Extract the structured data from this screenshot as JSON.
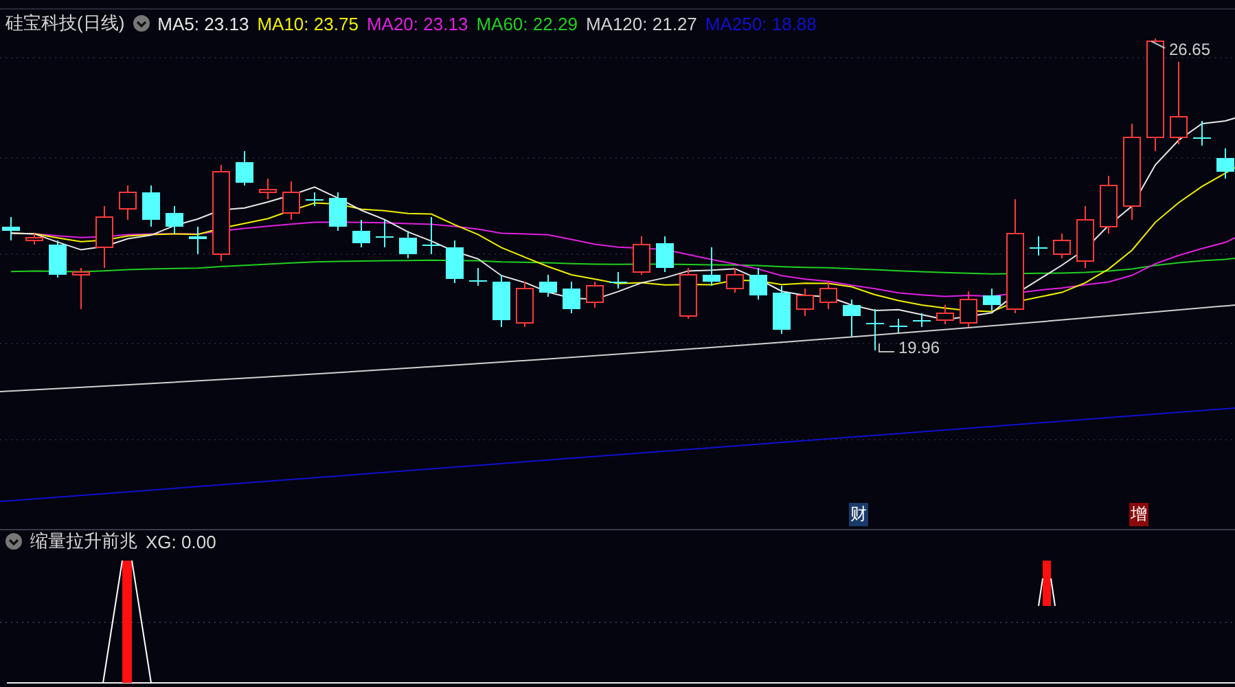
{
  "header": {
    "title": "硅宝科技(日线)",
    "readings": [
      {
        "label": "MA5:",
        "value": "23.13",
        "color": "#e8e8e8"
      },
      {
        "label": "MA10:",
        "value": "23.75",
        "color": "#f0f000"
      },
      {
        "label": "MA20:",
        "value": "23.13",
        "color": "#e020e0"
      },
      {
        "label": "MA60:",
        "value": "22.29",
        "color": "#20d020"
      },
      {
        "label": "MA120:",
        "value": "21.27",
        "color": "#d0d0d0"
      },
      {
        "label": "MA250:",
        "value": "18.88",
        "color": "#1010d0"
      }
    ]
  },
  "price_labels": [
    {
      "kind": "high",
      "text": "26.65"
    },
    {
      "kind": "low",
      "text": "19.96"
    }
  ],
  "event_markers": [
    {
      "text": "财",
      "color": "#1a3a6a"
    },
    {
      "text": "增",
      "color": "#8a0a0a"
    }
  ],
  "indicator": {
    "title": "缩量拉升前兆",
    "reading": "XG: 0.00"
  }
}
